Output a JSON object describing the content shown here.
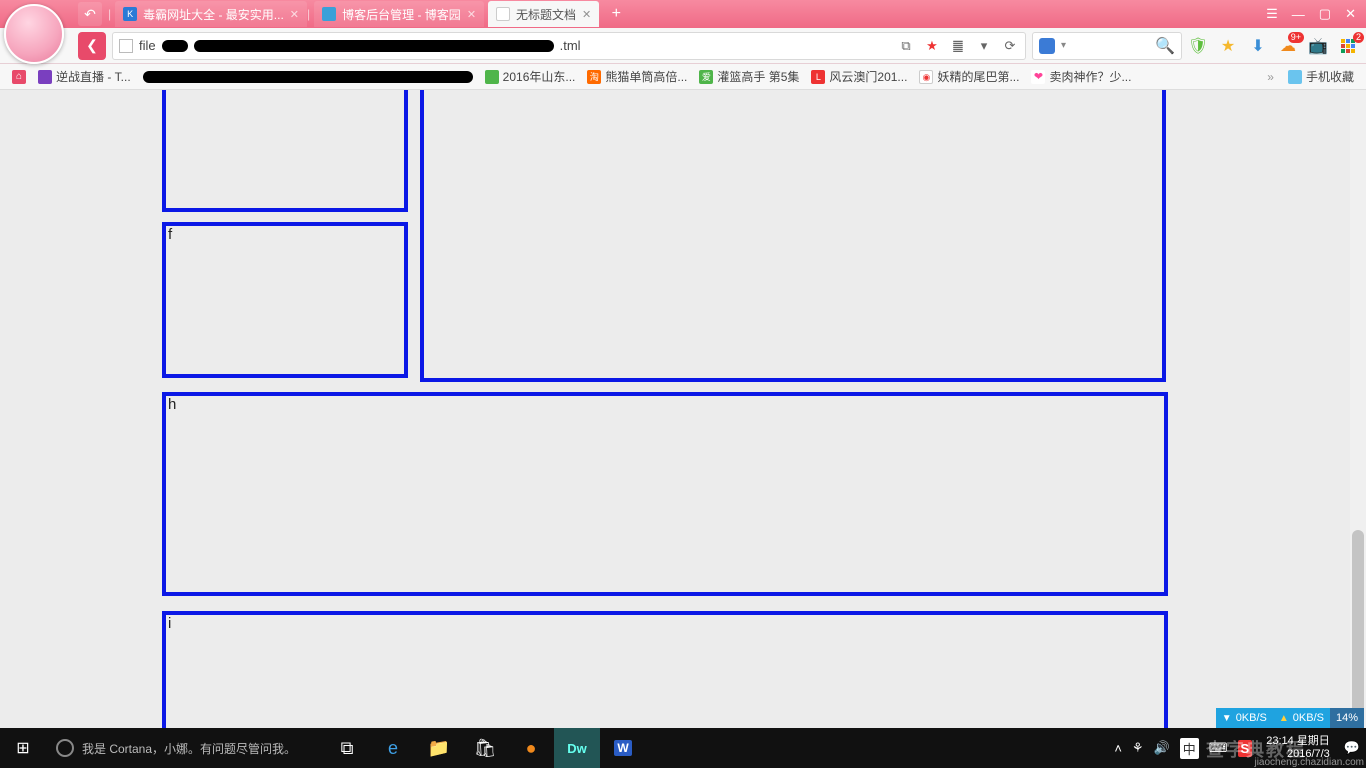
{
  "colors": {
    "accent": "#f06a86",
    "box_border": "#0b18e6",
    "taskbar": "#111"
  },
  "tabs": [
    {
      "title": "毒霸网址大全 - 最安实用...",
      "favicon_bg": "#2a7ad6",
      "active": false
    },
    {
      "title": "博客后台管理 - 博客园",
      "favicon_bg": "#3aa0d8",
      "active": false
    },
    {
      "title": "无标题文档",
      "favicon_bg": "#ffffff",
      "active": true
    }
  ],
  "url": {
    "prefix": "file",
    "suffix": ".tml"
  },
  "url_ctrls": {
    "readmode": "⧉",
    "star": "★",
    "translate": "䷀",
    "dropdown": "▾",
    "refresh": "⟳"
  },
  "ext": {
    "shield": "🛡",
    "shield_color": "#5fbf3e",
    "star": "★",
    "star_color": "#f5b82e",
    "download": "⬇",
    "download_color": "#3a8ed6",
    "cloud": "☁",
    "cloud_color": "#f0891c",
    "cloud_badge": "9+",
    "tv": "📺",
    "tv_color": "#3aa0d8",
    "grid": "▦",
    "grid_badge": "2"
  },
  "bookmarks": [
    {
      "label": "",
      "icon_bg": "#e84a6a",
      "icon_text": "⌂"
    },
    {
      "label": "逆战直播 - T...",
      "icon_bg": "#7a3fbf"
    },
    {
      "label": "",
      "redacted": true
    },
    {
      "label": "2016年山东...",
      "icon_bg": "#4fb54a"
    },
    {
      "label": "熊猫单筒高倍...",
      "icon_bg": "#ff6a00",
      "icon_text": "淘"
    },
    {
      "label": "灌篮高手 第5集",
      "icon_bg": "#4fb54a",
      "icon_text": "爱"
    },
    {
      "label": "风云澳门201...",
      "icon_bg": "#e33",
      "icon_text": "L"
    },
    {
      "label": "妖精的尾巴第...",
      "icon_bg": "#fff",
      "icon_text": "◉"
    },
    {
      "label": "卖肉神作？少...",
      "icon_bg": "#f49",
      "icon_text": "❤"
    }
  ],
  "bookmark_right": {
    "label": "手机收藏",
    "icon_bg": "#6ac4ee"
  },
  "page_boxes": {
    "f": "f",
    "h": "h",
    "i": "i"
  },
  "network": {
    "down": "0KB/S",
    "up": "0KB/S",
    "percent": "14%"
  },
  "cortana": "我是 Cortana，小娜。有问题尽管问我。",
  "tray": {
    "ime_lang": "中",
    "time": "23:14",
    "day": "星期日",
    "date": "2016/7/3"
  },
  "watermark": "查字典教程",
  "watermark_url": "jiaocheng.chazidian.com"
}
